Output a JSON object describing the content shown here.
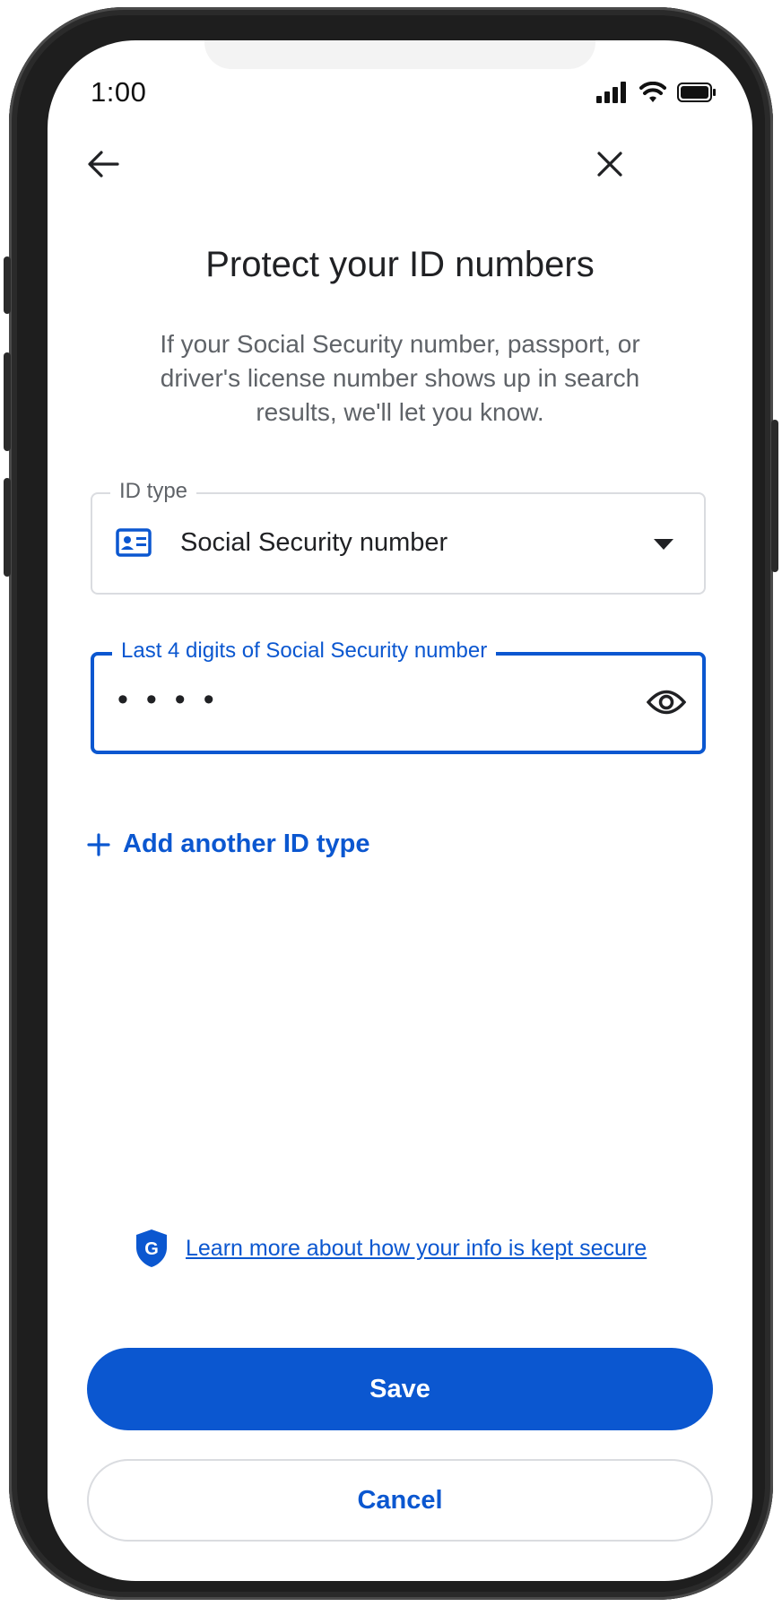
{
  "status_bar": {
    "time": "1:00"
  },
  "header": {
    "back_icon": "arrow-left-icon",
    "close_icon": "close-icon",
    "title": "Protect your ID numbers",
    "subtitle": "If your Social Security number, passport, or driver's license number shows up in search results, we'll let you know."
  },
  "id_type_field": {
    "label": "ID type",
    "value": "Social Security number",
    "icon": "id-card-icon"
  },
  "digits_field": {
    "label": "Last 4 digits of Social Security number",
    "value": "••••",
    "toggle_icon": "eye-icon"
  },
  "add_id": {
    "label": "Add another ID type",
    "icon": "plus-icon"
  },
  "security": {
    "link": "Learn more about how your info is kept secure",
    "icon": "google-shield-icon"
  },
  "actions": {
    "save": "Save",
    "cancel": "Cancel"
  },
  "colors": {
    "primary": "#0b57d0",
    "text": "#202124",
    "secondary_text": "#5f6368",
    "border": "#dadce0"
  }
}
